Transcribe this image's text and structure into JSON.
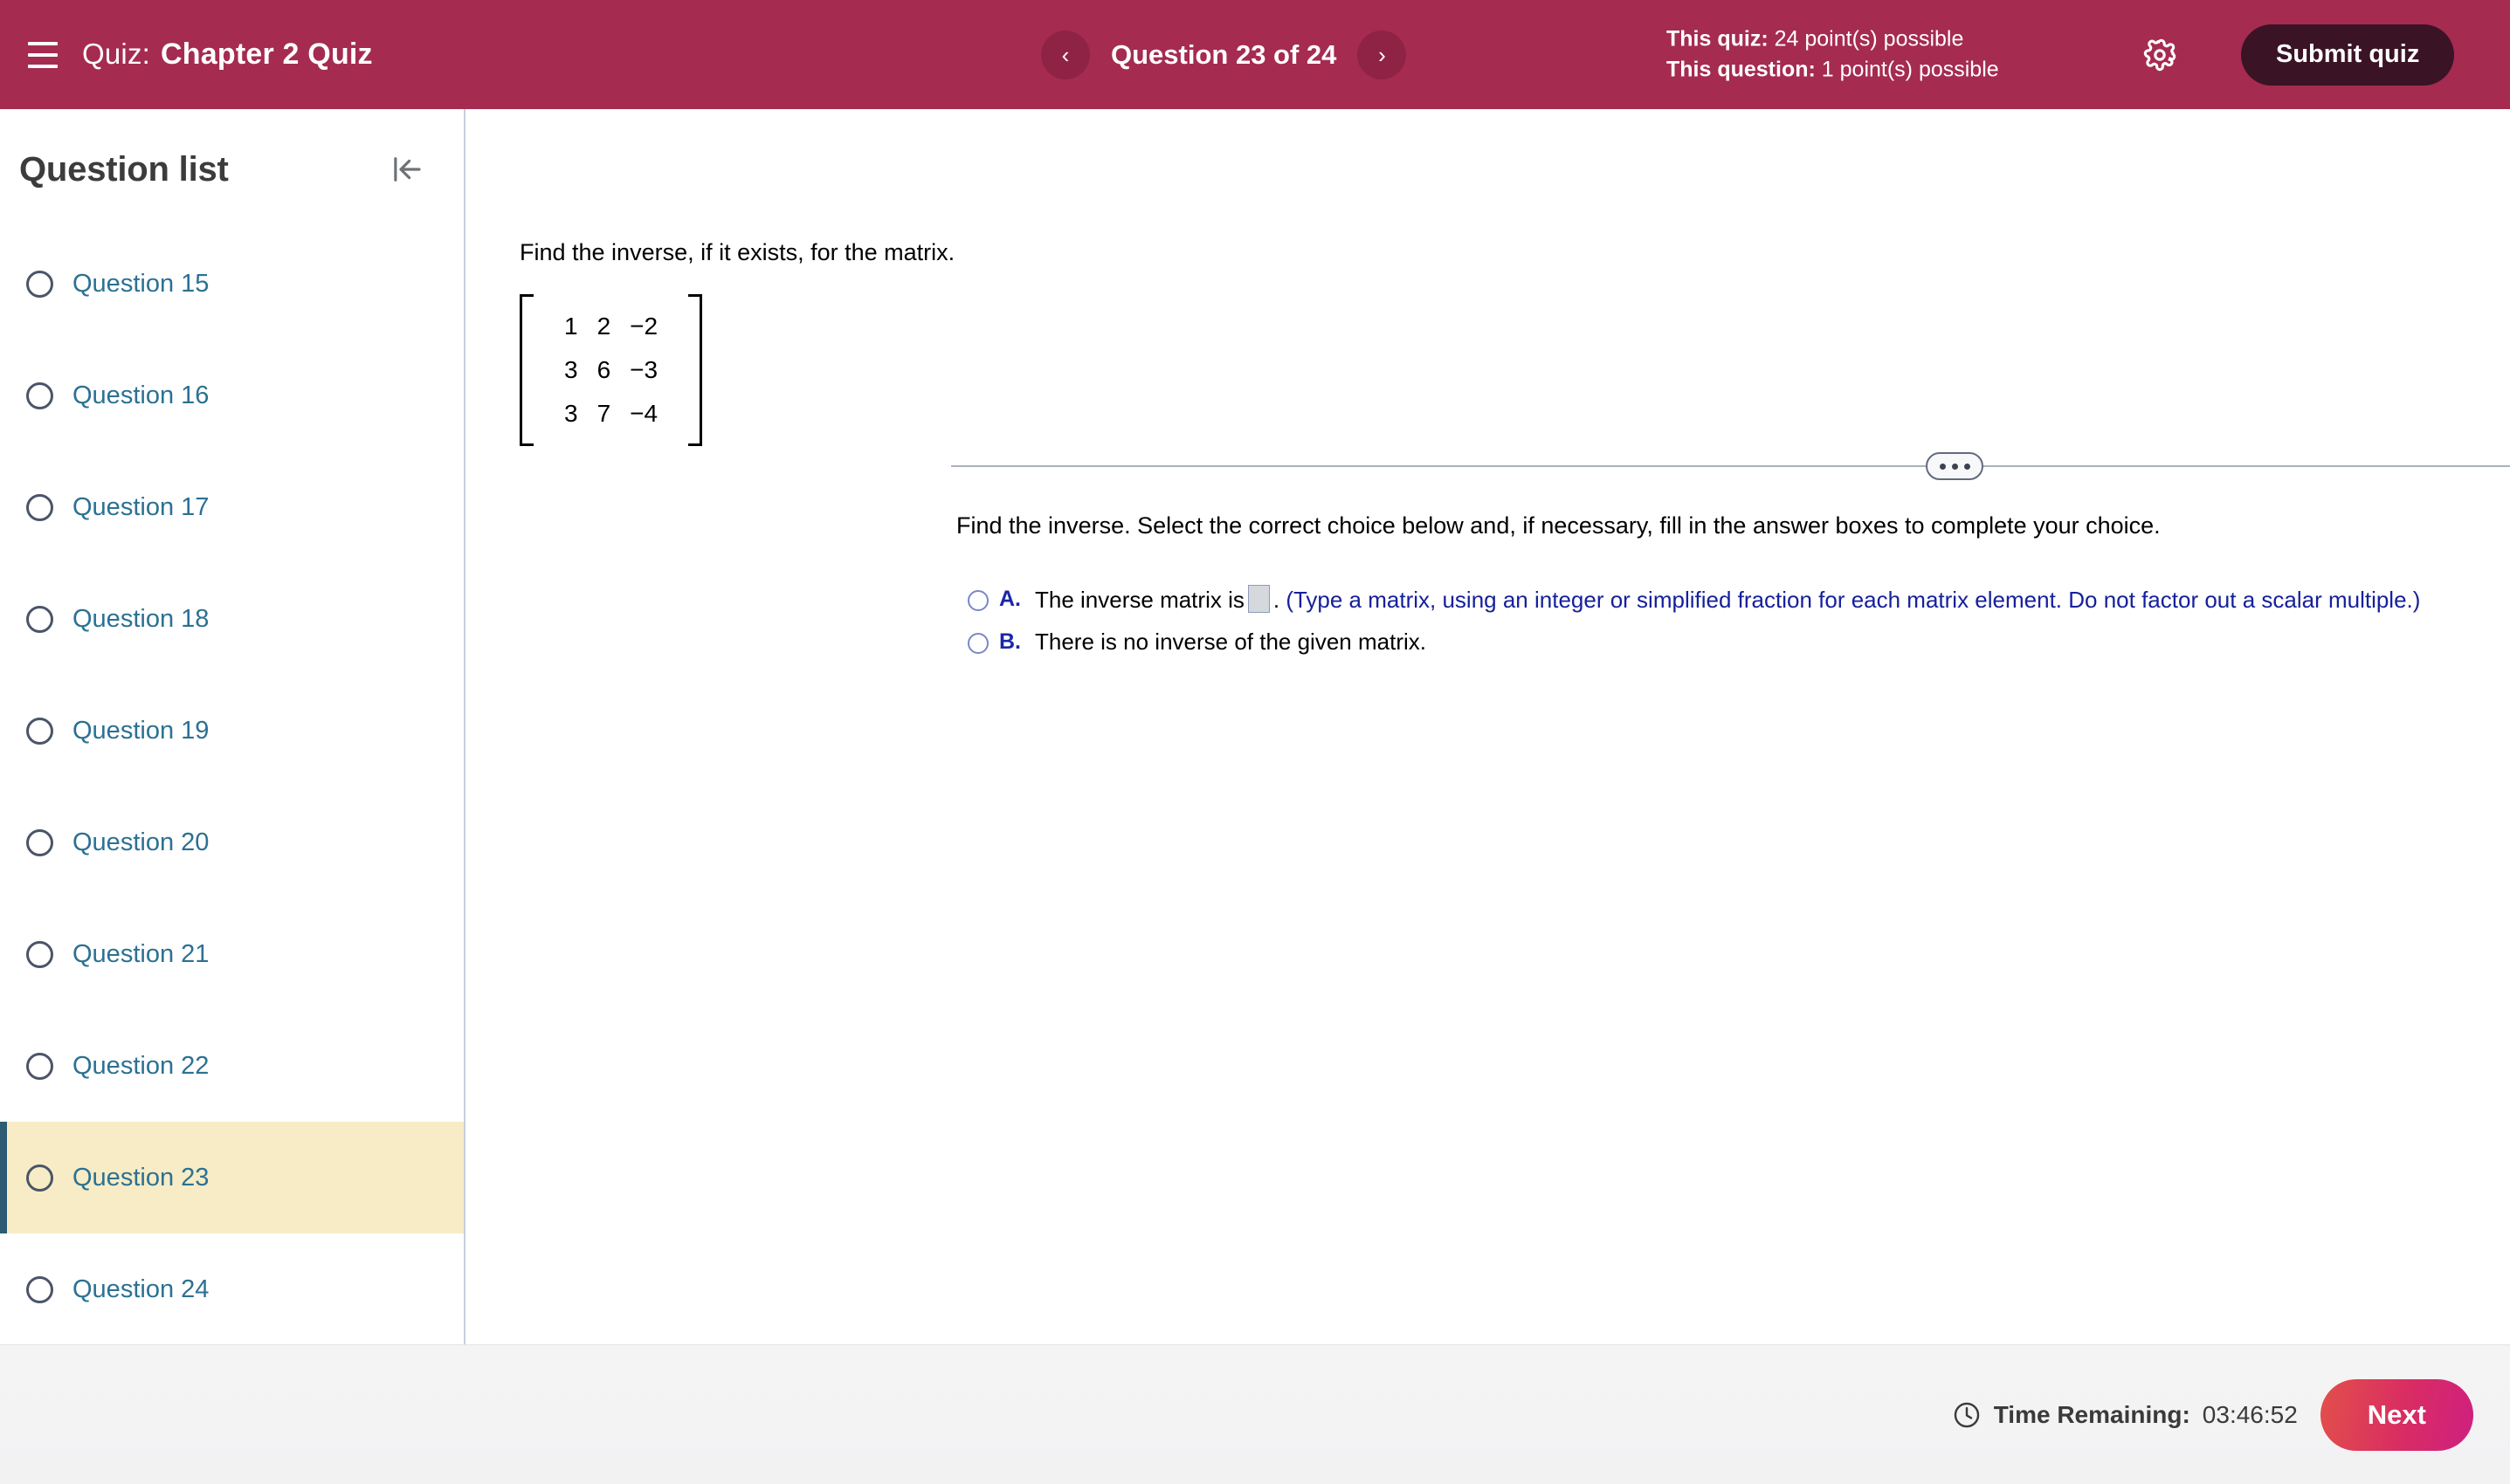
{
  "header": {
    "menu_icon": "hamburger-icon",
    "quiz_label": "Quiz:",
    "quiz_name": "Chapter 2 Quiz",
    "prev_icon": "‹",
    "next_icon": "›",
    "question_counter": "Question 23 of 24",
    "quiz_points_label": "This quiz:",
    "quiz_points_value": "24 point(s) possible",
    "question_points_label": "This question:",
    "question_points_value": "1 point(s) possible",
    "settings_icon": "gear-icon",
    "submit_label": "Submit quiz",
    "background_color": "#A52B51",
    "submit_color": "#3A1324"
  },
  "sidebar": {
    "title": "Question list",
    "collapse_icon": "collapse-left-icon",
    "active_index": 8,
    "highlight_color": "#F7ECC5",
    "accent_color": "#2C5B73",
    "link_color": "#2B7193",
    "items": [
      {
        "label": "Question 15"
      },
      {
        "label": "Question 16"
      },
      {
        "label": "Question 17"
      },
      {
        "label": "Question 18"
      },
      {
        "label": "Question 19"
      },
      {
        "label": "Question 20"
      },
      {
        "label": "Question 21"
      },
      {
        "label": "Question 22"
      },
      {
        "label": "Question 23"
      },
      {
        "label": "Question 24"
      }
    ]
  },
  "main": {
    "stem": "Find the inverse, if it exists, for the matrix.",
    "matrix": {
      "rows": [
        [
          "1",
          "2",
          "−2"
        ],
        [
          "3",
          "6",
          "−3"
        ],
        [
          "3",
          "7",
          "−4"
        ]
      ]
    },
    "divider_icon": "ellipsis-toggle-icon",
    "instruction": "Find the inverse. Select the correct choice below and, if necessary, fill in the answer boxes to complete your choice.",
    "choices": [
      {
        "letter": "A.",
        "text_before": "The inverse matrix is",
        "answer_box_value": "",
        "text_after": ".",
        "hint": "(Type a matrix, using an integer or simplified fraction for each matrix element. Do not factor out a scalar multiple.)"
      },
      {
        "letter": "B.",
        "text_before": "There is no inverse of the given matrix.",
        "answer_box_value": "",
        "text_after": "",
        "hint": ""
      }
    ]
  },
  "footer": {
    "clock_icon": "clock-icon",
    "time_label": "Time Remaining:",
    "time_value": "03:46:52",
    "next_label": "Next"
  }
}
